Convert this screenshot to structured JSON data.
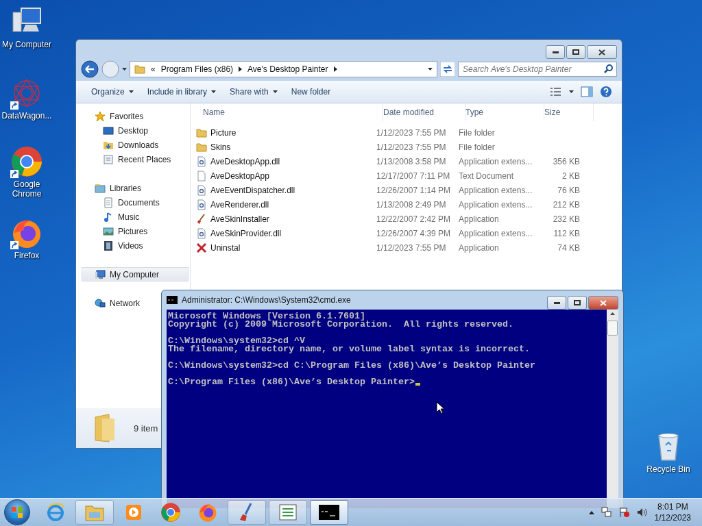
{
  "desktop_icons": [
    {
      "label": "My Computer",
      "kind": "computer",
      "shortcut": false
    },
    {
      "label": "DataWagon...",
      "kind": "star",
      "shortcut": true
    },
    {
      "label": "Google Chrome",
      "kind": "chrome",
      "shortcut": true
    },
    {
      "label": "Firefox",
      "kind": "firefox",
      "shortcut": true
    },
    {
      "label": "Recycle Bin",
      "kind": "bin",
      "shortcut": false
    }
  ],
  "explorer": {
    "address_overflow": "«",
    "address": [
      "Program Files (x86)",
      "Ave's Desktop Painter"
    ],
    "search": {
      "placeholder": "Search Ave's Desktop Painter"
    },
    "toolbar": [
      {
        "label": "Organize",
        "dropdown": true
      },
      {
        "label": "Include in library",
        "dropdown": true
      },
      {
        "label": "Share with",
        "dropdown": true
      },
      {
        "label": "New folder",
        "dropdown": false
      }
    ],
    "nav": [
      {
        "label": "Favorites",
        "kind": "star",
        "selected": false,
        "children": [
          {
            "label": "Desktop",
            "kind": "desktop",
            "selected": false
          },
          {
            "label": "Downloads",
            "kind": "downloads",
            "selected": false
          },
          {
            "label": "Recent Places",
            "kind": "recent",
            "selected": false
          }
        ]
      },
      {
        "label": "Libraries",
        "kind": "library",
        "selected": false,
        "children": [
          {
            "label": "Documents",
            "kind": "document",
            "selected": false
          },
          {
            "label": "Music",
            "kind": "music",
            "selected": false
          },
          {
            "label": "Pictures",
            "kind": "pictures",
            "selected": false
          },
          {
            "label": "Videos",
            "kind": "videos",
            "selected": false
          }
        ]
      },
      {
        "label": "My Computer",
        "kind": "computer",
        "selected": true
      },
      {
        "label": "Network",
        "kind": "network",
        "selected": false
      }
    ],
    "columns": [
      "Name",
      "Date modified",
      "Type",
      "Size"
    ],
    "rows": [
      {
        "name": "Picture",
        "date": "1/12/2023 7:55 PM",
        "type": "File folder",
        "kind": "folder"
      },
      {
        "name": "Skins",
        "date": "1/12/2023 7:55 PM",
        "type": "File folder",
        "kind": "folder"
      },
      {
        "name": "AveDesktopApp.dll",
        "date": "1/13/2008 3:58 PM",
        "type": "Application extens...",
        "size": "356 KB",
        "kind": "dll"
      },
      {
        "name": "AveDesktopApp",
        "date": "12/17/2007 7:11 PM",
        "type": "Text Document",
        "size": "2 KB",
        "kind": "text"
      },
      {
        "name": "AveEventDispatcher.dll",
        "date": "12/26/2007 1:14 PM",
        "type": "Application extens...",
        "size": "76 KB",
        "kind": "dll"
      },
      {
        "name": "AveRenderer.dll",
        "date": "1/13/2008 2:49 PM",
        "type": "Application extens...",
        "size": "212 KB",
        "kind": "dll"
      },
      {
        "name": "AveSkinInstaller",
        "date": "12/22/2007 2:42 PM",
        "type": "Application",
        "size": "232 KB",
        "kind": "brush"
      },
      {
        "name": "AveSkinProvider.dll",
        "date": "12/26/2007 4:39 PM",
        "type": "Application extens...",
        "size": "112 KB",
        "kind": "dll"
      },
      {
        "name": "Uninstal",
        "date": "1/12/2023 7:55 PM",
        "type": "Application",
        "size": "74 KB",
        "kind": "uninstall"
      }
    ],
    "status": "9 item"
  },
  "console": {
    "title": "Administrator: C:\\Windows\\System32\\cmd.exe",
    "cursor": true,
    "blocks": [
      [
        "Microsoft Windows [Version 6.1.7601]",
        "Copyright (c) 2009 Microsoft Corporation.  All rights reserved."
      ],
      [
        "C:\\Windows\\system32>cd ^V",
        "The filename, directory name, or volume label syntax is incorrect."
      ],
      [
        "C:\\Windows\\system32>cd C:\\Program Files (x86)\\Ave’s Desktop Painter"
      ],
      [
        "C:\\Program Files (x86)\\Ave’s Desktop Painter>"
      ]
    ]
  },
  "taskbar": {
    "apps": [
      {
        "kind": "ie",
        "open": false,
        "selected": false
      },
      {
        "kind": "explorer",
        "open": true,
        "selected": false
      },
      {
        "kind": "media",
        "open": false,
        "selected": false
      },
      {
        "kind": "chrome",
        "open": false,
        "selected": false
      },
      {
        "kind": "firefox",
        "open": false,
        "selected": false
      },
      {
        "kind": "paint",
        "open": true,
        "selected": false
      },
      {
        "kind": "notepad",
        "open": true,
        "selected": false
      },
      {
        "kind": "cmd",
        "open": true,
        "selected": true
      }
    ],
    "time": "8:01 PM",
    "date": "1/12/2023"
  }
}
